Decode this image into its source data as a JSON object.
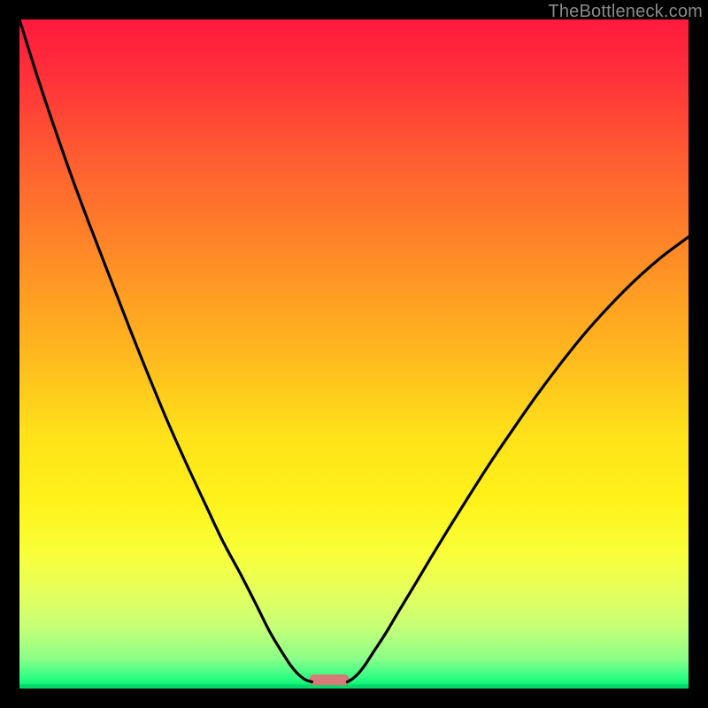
{
  "watermark": "TheBottleneck.com",
  "chart_data": {
    "type": "line",
    "title": "",
    "xlabel": "",
    "ylabel": "",
    "xlim": [
      0,
      100
    ],
    "ylim": [
      0,
      100
    ],
    "grid": false,
    "legend": false,
    "notes": "Large gradient-filled square (rainbow from red at top through orange/yellow to green near the very bottom). Two black curves: the left one starts at the top-left and descends steeply to a minimum near x≈44, y≈1; the right one rises from that same minimum up toward the top-right, flattening out near y≈72 at x=100. A small rounded salmon-colored bar sits between the two curve bases near the bottom. A thin bright-green strip sits at the very bottom edge.",
    "gradient_stops": [
      {
        "offset": 0.0,
        "color": "#ff1a3d"
      },
      {
        "offset": 0.08,
        "color": "#ff2f3a"
      },
      {
        "offset": 0.2,
        "color": "#ff5a31"
      },
      {
        "offset": 0.35,
        "color": "#ff8a27"
      },
      {
        "offset": 0.5,
        "color": "#ffb81e"
      },
      {
        "offset": 0.62,
        "color": "#ffe11a"
      },
      {
        "offset": 0.72,
        "color": "#fff21a"
      },
      {
        "offset": 0.8,
        "color": "#f8ff3a"
      },
      {
        "offset": 0.86,
        "color": "#e3ff5e"
      },
      {
        "offset": 0.91,
        "color": "#c4ff78"
      },
      {
        "offset": 0.955,
        "color": "#8cff88"
      },
      {
        "offset": 0.985,
        "color": "#2bff84"
      },
      {
        "offset": 1.0,
        "color": "#00e66b"
      }
    ],
    "series": [
      {
        "name": "left-curve",
        "x": [
          0.0,
          2.5,
          5.0,
          7.8,
          10.6,
          13.5,
          16.4,
          19.2,
          22.1,
          25.0,
          27.8,
          30.4,
          33.1,
          35.4,
          37.4,
          39.2,
          40.5,
          41.5,
          42.3,
          43.0,
          43.7
        ],
        "y": [
          100.0,
          92.0,
          84.5,
          76.5,
          69.0,
          61.5,
          54.0,
          47.0,
          40.0,
          33.5,
          27.5,
          22.0,
          17.0,
          12.5,
          8.5,
          5.5,
          3.5,
          2.3,
          1.6,
          1.2,
          1.0
        ]
      },
      {
        "name": "right-curve",
        "x": [
          49.0,
          49.7,
          50.6,
          51.7,
          53.0,
          54.7,
          56.6,
          58.9,
          61.4,
          64.2,
          67.2,
          70.4,
          73.8,
          77.3,
          80.9,
          84.6,
          88.4,
          92.2,
          96.1,
          100.0
        ],
        "y": [
          1.0,
          1.4,
          2.2,
          3.6,
          5.6,
          8.2,
          11.4,
          15.2,
          19.4,
          24.0,
          28.8,
          33.8,
          38.8,
          43.8,
          48.6,
          53.2,
          57.4,
          61.2,
          64.6,
          67.5
        ]
      }
    ],
    "marker": {
      "name": "base-marker",
      "x_center": 46.3,
      "width": 6.0,
      "y": 1.3,
      "height": 1.6,
      "color": "#d87a78"
    },
    "bottom_strip": {
      "y_top": 0.6,
      "color": "#00d867"
    }
  }
}
